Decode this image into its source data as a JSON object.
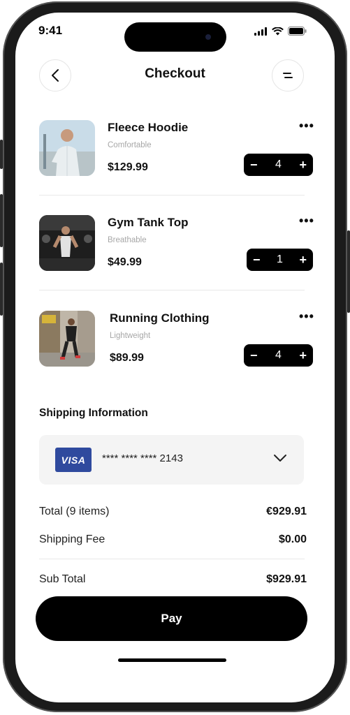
{
  "status_bar": {
    "time": "9:41"
  },
  "header": {
    "title": "Checkout",
    "back_icon": "chevron-left-icon",
    "menu_icon": "menu-icon"
  },
  "items": [
    {
      "name": "Fleece Hoodie",
      "subtitle": "Comfortable",
      "price": "$129.99",
      "quantity": "4"
    },
    {
      "name": "Gym Tank Top",
      "subtitle": "Breathable",
      "price": "$49.99",
      "quantity": "1"
    },
    {
      "name": "Running Clothing",
      "subtitle": "Lightweight",
      "price": "$89.99",
      "quantity": "4"
    }
  ],
  "more_label": "•••",
  "stepper": {
    "minus": "−",
    "plus": "+"
  },
  "shipping": {
    "title": "Shipping Information",
    "card_brand": "VISA",
    "card_number": "**** **** **** 2143",
    "brand_color": "#2f4a9e"
  },
  "summary": {
    "total_label": "Total (9 items)",
    "total_value": "€929.91",
    "shipping_label": "Shipping Fee",
    "shipping_value": "$0.00",
    "subtotal_label": "Sub Total",
    "subtotal_value": "$929.91"
  },
  "pay_label": "Pay"
}
